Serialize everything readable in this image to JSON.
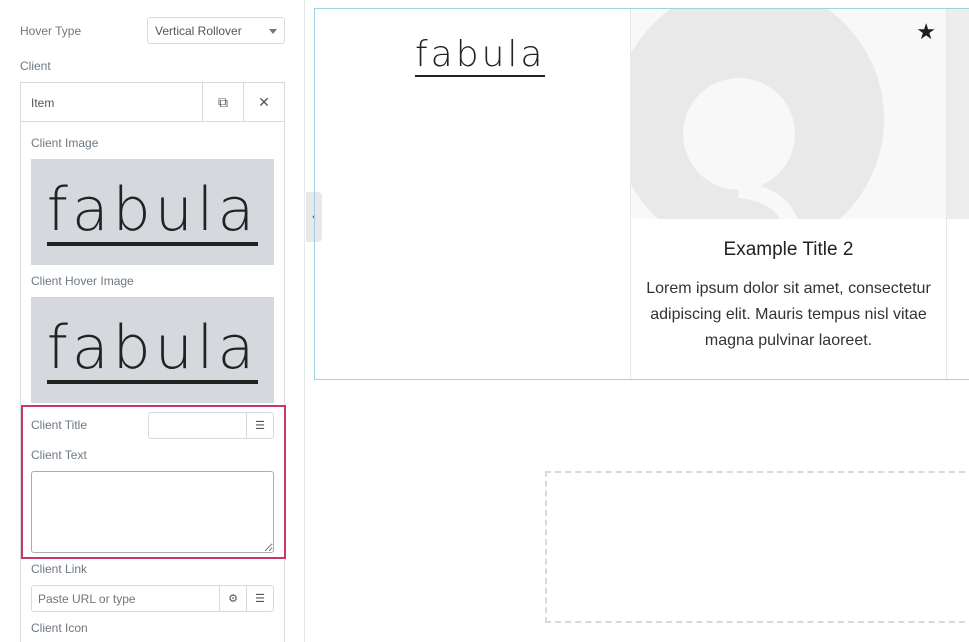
{
  "panel": {
    "hover_type_label": "Hover Type",
    "hover_type_value": "Vertical Rollover",
    "client_label": "Client",
    "item": {
      "title": "Item",
      "client_image_label": "Client Image",
      "client_image_logo": "fabula",
      "client_hover_image_label": "Client Hover Image",
      "client_hover_image_logo": "fabula",
      "client_title_label": "Client Title",
      "client_title_value": "",
      "client_text_label": "Client Text",
      "client_text_value": "",
      "client_link_label": "Client Link",
      "client_link_placeholder": "Paste URL or type",
      "client_icon_label": "Client Icon"
    }
  },
  "preview": {
    "col1_logo": "fabula",
    "col2": {
      "title": "Example Title 2",
      "text": "Lorem ipsum dolor sit amet, consectetur adipiscing elit. Mauris tempus nisl vitae magna pulvinar laoreet.",
      "icon": "star-icon"
    }
  },
  "colors": {
    "highlight": "#c8366a",
    "preview_border": "#9fd3e2"
  }
}
